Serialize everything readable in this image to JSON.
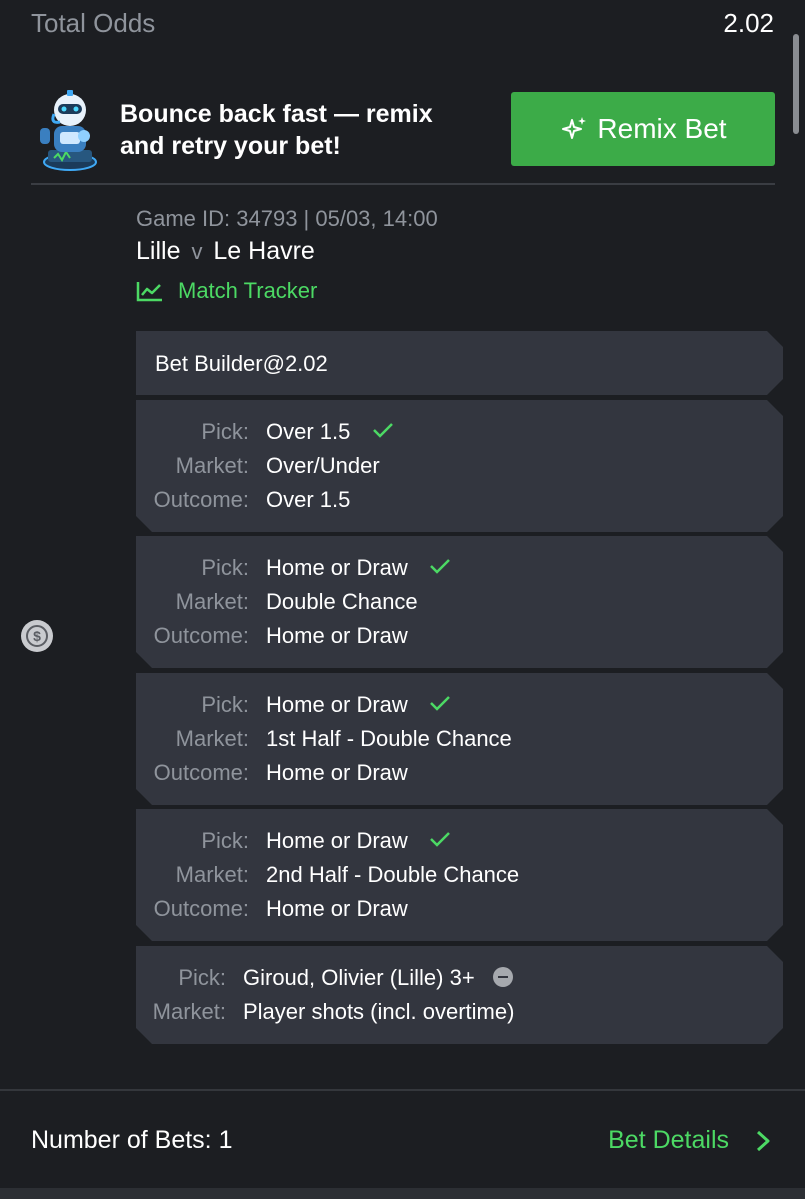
{
  "header": {
    "total_odds_label": "Total Odds",
    "total_odds_value": "2.02"
  },
  "promo": {
    "line1": "Bounce back fast — remix",
    "line2": "and retry your bet!",
    "button_label": "Remix Bet",
    "button_icon": "sparkle-icon",
    "mascot_icon": "robot-mascot-icon"
  },
  "game": {
    "id_line": "Game ID: 34793 | 05/03, 14:00",
    "home": "Lille",
    "vs": "v",
    "away": "Le Havre",
    "tracker_label": "Match Tracker",
    "tracker_icon": "line-chart-icon"
  },
  "bet_builder": {
    "title": "Bet Builder@2.02"
  },
  "selections": [
    {
      "pick_label": "Pick:",
      "pick": "Over 1.5",
      "market_label": "Market:",
      "market": "Over/Under",
      "outcome_label": "Outcome:",
      "outcome": "Over 1.5",
      "status": "won"
    },
    {
      "pick_label": "Pick:",
      "pick": "Home or Draw",
      "market_label": "Market:",
      "market": "Double Chance",
      "outcome_label": "Outcome:",
      "outcome": "Home or Draw",
      "status": "won"
    },
    {
      "pick_label": "Pick:",
      "pick": "Home or Draw",
      "market_label": "Market:",
      "market": "1st Half - Double Chance",
      "outcome_label": "Outcome:",
      "outcome": "Home or Draw",
      "status": "won"
    },
    {
      "pick_label": "Pick:",
      "pick": "Home or Draw",
      "market_label": "Market:",
      "market": "2nd Half - Double Chance",
      "outcome_label": "Outcome:",
      "outcome": "Home or Draw",
      "status": "won"
    },
    {
      "pick_label": "Pick:",
      "pick": "Giroud, Olivier (Lille) 3+",
      "market_label": "Market:",
      "market": "Player shots (incl. overtime)",
      "status": "void"
    }
  ],
  "footer": {
    "bets_label": "Number of Bets: 1",
    "details_label": "Bet Details"
  },
  "colors": {
    "background": "#1c1e22",
    "card": "#33363f",
    "accent_green": "#4cd964",
    "button_green": "#3cab48",
    "muted_text": "#8f949c"
  }
}
